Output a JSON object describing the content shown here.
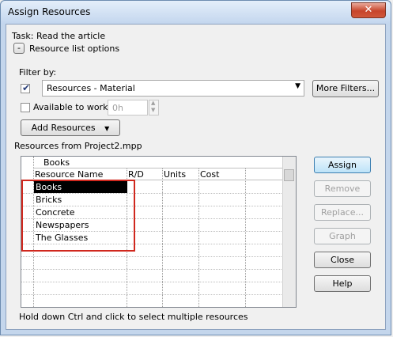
{
  "window": {
    "title": "Assign Resources",
    "close_glyph": "✕"
  },
  "task": {
    "label": "Task: Read the article"
  },
  "resource_options": {
    "toggle": "-",
    "label": "Resource list options"
  },
  "filter": {
    "label": "Filter by:",
    "checked": true,
    "value": "Resources - Material",
    "more_filters": "More Filters..."
  },
  "available": {
    "label": "Available to work",
    "checked": false,
    "hours": "0h"
  },
  "add_resources": {
    "label": "Add Resources"
  },
  "resources_from": "Resources from Project2.mpp",
  "grid": {
    "edit_value": "Books",
    "columns": [
      "Resource Name",
      "R/D",
      "Units",
      "Cost"
    ],
    "rows": [
      "Books",
      "Bricks",
      "Concrete",
      "Newspapers",
      "The Glasses"
    ],
    "selected_row": "Books"
  },
  "buttons": {
    "assign": "Assign",
    "remove": "Remove",
    "replace": "Replace...",
    "graph": "Graph",
    "close": "Close",
    "help": "Help"
  },
  "hint": "Hold down Ctrl and click to select multiple resources",
  "colors": {
    "highlight": "#d0281e",
    "title_bar": "#c4d6ec"
  }
}
